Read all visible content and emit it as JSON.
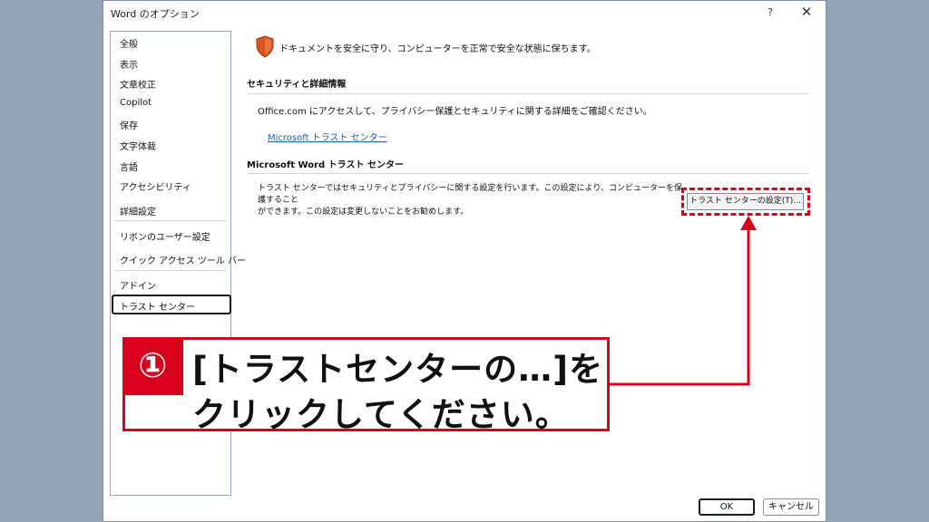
{
  "window": {
    "title": "Word のオプション",
    "help": "?",
    "close": "✕"
  },
  "sidebar": {
    "items": [
      "全般",
      "表示",
      "文章校正",
      "Copilot",
      "保存",
      "文字体裁",
      "言語",
      "アクセシビリティ",
      "詳細設定",
      "リボンのユーザー設定",
      "クイック アクセス ツール バー",
      "アドイン",
      "トラスト センター"
    ],
    "selected": "トラスト センター"
  },
  "main": {
    "description": "ドキュメントを安全に守り、コンピューターを正常で安全な状態に保ちます。",
    "section1": {
      "heading": "セキュリティと詳細情報",
      "text": "Office.com にアクセスして、プライバシー保護とセキュリティに関する詳細をご確認ください。",
      "link": "Microsoft トラスト センター"
    },
    "section2": {
      "heading": "Microsoft Word トラスト センター",
      "text_line1": "トラスト センターではセキュリティとプライバシーに関する設定を行います。この設定により、コンピューターを保護すること",
      "text_line2": "ができます。この設定は変更しないことをお勧めします。",
      "button": "トラスト センターの設定(T)..."
    }
  },
  "footer": {
    "ok": "OK",
    "cancel": "キャンセル"
  },
  "annotation": {
    "number": "①",
    "line1": "[トラストセンターの…]を",
    "line2": "クリックしてください。",
    "color": "#d9001b"
  },
  "colors": {
    "shield": "#d9531e",
    "link": "#1a5fb4",
    "backdrop": "#8fa4b8"
  }
}
